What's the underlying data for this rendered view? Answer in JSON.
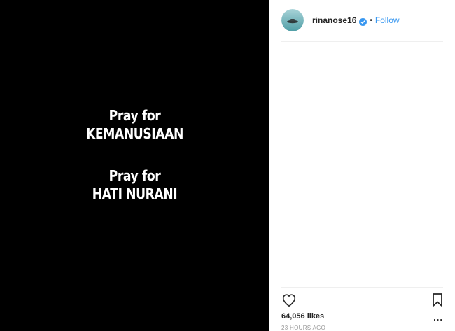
{
  "post": {
    "image_lines": [
      "Pray for",
      "KEMANUSIAAN",
      "Pray for",
      "HATI NURANI"
    ]
  },
  "header": {
    "username": "rinanose16",
    "verified_icon": "verified-badge-icon",
    "separator": "•",
    "follow_label": "Follow"
  },
  "actions": {
    "like_icon": "heart-icon",
    "save_icon": "bookmark-icon",
    "more_icon": "more-options-icon",
    "more_label": "..."
  },
  "stats": {
    "likes": "64,056 likes",
    "timestamp": "23 HOURS AGO"
  },
  "colors": {
    "media_background": "#000000",
    "accent": "#3897f0",
    "verified": "#3897f0",
    "text": "#262626",
    "muted": "#999999"
  }
}
